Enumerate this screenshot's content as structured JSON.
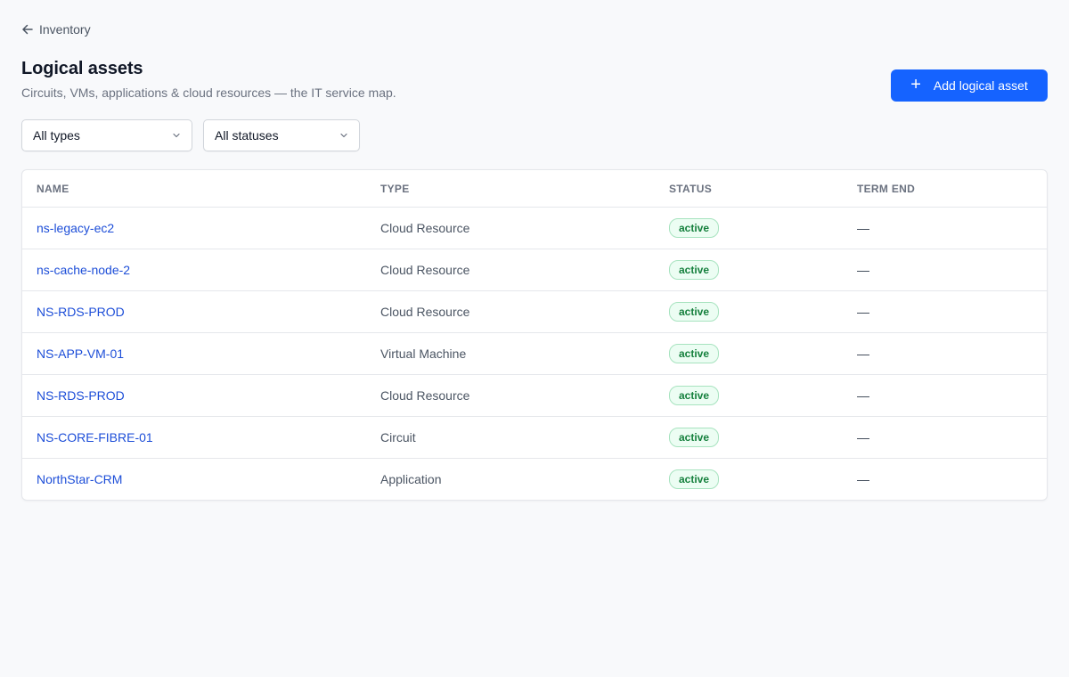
{
  "breadcrumb": {
    "back_label": "Inventory"
  },
  "header": {
    "title": "Logical assets",
    "subtitle": "Circuits, VMs, applications & cloud resources — the IT service map.",
    "add_button_label": "Add logical asset"
  },
  "filters": {
    "type_selected": "All types",
    "status_selected": "All statuses"
  },
  "table": {
    "columns": [
      "NAME",
      "TYPE",
      "STATUS",
      "TERM END"
    ],
    "rows": [
      {
        "name": "ns-legacy-ec2",
        "type": "Cloud Resource",
        "status": "active",
        "term_end": "—"
      },
      {
        "name": "ns-cache-node-2",
        "type": "Cloud Resource",
        "status": "active",
        "term_end": "—"
      },
      {
        "name": "NS-RDS-PROD",
        "type": "Cloud Resource",
        "status": "active",
        "term_end": "—"
      },
      {
        "name": "NS-APP-VM-01",
        "type": "Virtual Machine",
        "status": "active",
        "term_end": "—"
      },
      {
        "name": "NS-RDS-PROD",
        "type": "Cloud Resource",
        "status": "active",
        "term_end": "—"
      },
      {
        "name": "NS-CORE-FIBRE-01",
        "type": "Circuit",
        "status": "active",
        "term_end": "—"
      },
      {
        "name": "NorthStar-CRM",
        "type": "Application",
        "status": "active",
        "term_end": "—"
      }
    ]
  },
  "colors": {
    "accent": "#1563ff",
    "link": "#1d4ed8",
    "status_active_bg": "#ecfdf3",
    "status_active_text": "#15803d"
  },
  "icons": {
    "back": "arrow-left-icon",
    "add": "plus-icon",
    "dropdown": "chevron-down-icon"
  }
}
